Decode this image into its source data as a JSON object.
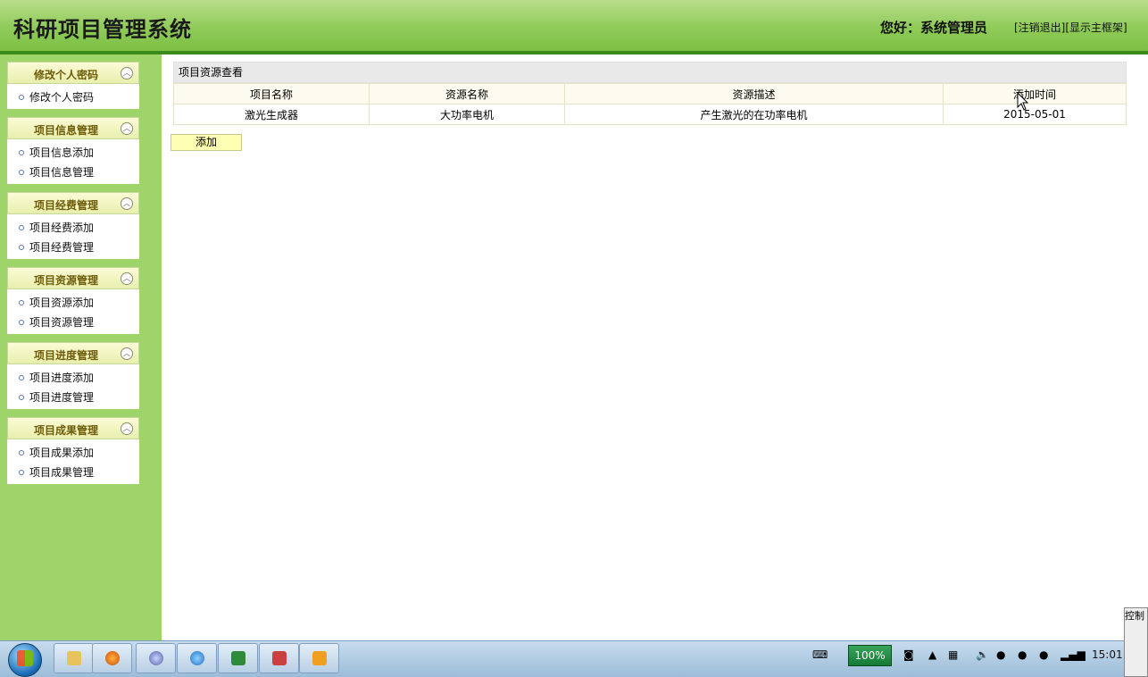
{
  "header": {
    "app_title": "科研项目管理系统",
    "greeting": "您好：系统管理员",
    "logout_link": "[注销退出]",
    "frame_link": "[显示主框架]"
  },
  "sidebar": {
    "panels": [
      {
        "title": "修改个人密码",
        "items": [
          "修改个人密码"
        ]
      },
      {
        "title": "项目信息管理",
        "items": [
          "项目信息添加",
          "项目信息管理"
        ]
      },
      {
        "title": "项目经费管理",
        "items": [
          "项目经费添加",
          "项目经费管理"
        ]
      },
      {
        "title": "项目资源管理",
        "items": [
          "项目资源添加",
          "项目资源管理"
        ]
      },
      {
        "title": "项目进度管理",
        "items": [
          "项目进度添加",
          "项目进度管理"
        ]
      },
      {
        "title": "项目成果管理",
        "items": [
          "项目成果添加",
          "项目成果管理"
        ]
      }
    ]
  },
  "main": {
    "table_title": "项目资源查看",
    "columns": [
      "项目名称",
      "资源名称",
      "资源描述",
      "添加时间"
    ],
    "rows": [
      [
        "激光生成器",
        "大功率电机",
        "产生激光的在功率电机",
        "2015-05-01"
      ]
    ],
    "add_button": "添加"
  },
  "taskbar": {
    "battery": "100%",
    "clock": "15:01",
    "popup_text": "控制"
  }
}
